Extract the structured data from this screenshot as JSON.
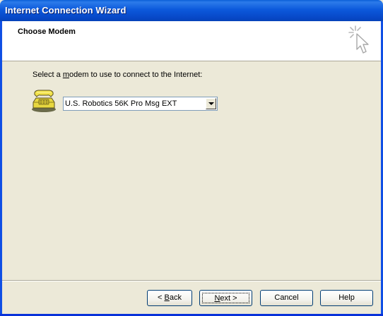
{
  "window": {
    "title": "Internet Connection Wizard"
  },
  "header": {
    "title": "Choose Modem",
    "icon": "wizard-cursor-icon"
  },
  "content": {
    "prompt_pre": "Select a ",
    "prompt_accel": "m",
    "prompt_post": "odem to use to connect to the Internet:",
    "modem_icon": "telephone-modem-icon",
    "modem_select": {
      "value": "U.S. Robotics 56K Pro Msg EXT"
    }
  },
  "buttons": {
    "back_pre": "< ",
    "back_accel": "B",
    "back_post": "ack",
    "next_accel": "N",
    "next_post": "ext >",
    "cancel": "Cancel",
    "help": "Help"
  },
  "colors": {
    "titlebar": "#0A5FD8",
    "dialog_bg": "#ECE9D8",
    "header_bg": "#FFFFFF",
    "button_border": "#003C74"
  }
}
